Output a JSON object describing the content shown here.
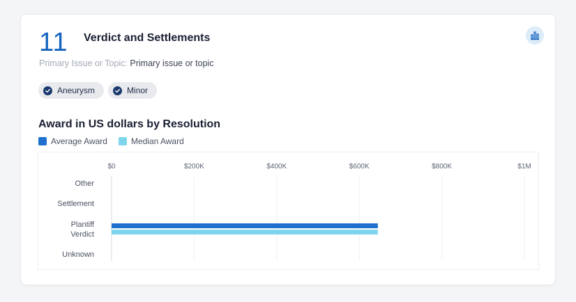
{
  "card": {
    "count": "11",
    "title": "Verdict and Settlements",
    "issue_label": "Primary Issue or Topic:",
    "issue_value": "Primary issue or topic",
    "chart_toggle_icon": "bar-chart-icon",
    "chips": [
      {
        "label": "Aneurysm",
        "icon": "check-circle-icon"
      },
      {
        "label": "Minor",
        "icon": "check-circle-icon"
      }
    ]
  },
  "colors": {
    "accent": "#1565c0",
    "average": "#1f6fcf",
    "median": "#7fd6ec",
    "chip_check": "#1a3a6e"
  },
  "chart_data": {
    "type": "bar",
    "orientation": "horizontal",
    "title": "Award in US dollars by Resolution",
    "categories": [
      "Other",
      "Settlement",
      "Plantiff Verdict",
      "Unknown"
    ],
    "category_lines": [
      [
        "Other"
      ],
      [
        "Settlement"
      ],
      [
        "Plantiff",
        "Verdict"
      ],
      [
        "Unknown"
      ]
    ],
    "series": [
      {
        "name": "Average Award",
        "values": [
          0,
          0,
          645000,
          0
        ]
      },
      {
        "name": "Median Award",
        "values": [
          0,
          0,
          645000,
          0
        ]
      }
    ],
    "x_ticks": [
      0,
      200000,
      400000,
      600000,
      800000,
      1000000
    ],
    "x_tick_labels": [
      "$0",
      "$200K",
      "$400K",
      "$600K",
      "$800K",
      "$1M"
    ],
    "xlim": [
      0,
      1000000
    ],
    "grid": true,
    "legend_position": "top-left"
  }
}
